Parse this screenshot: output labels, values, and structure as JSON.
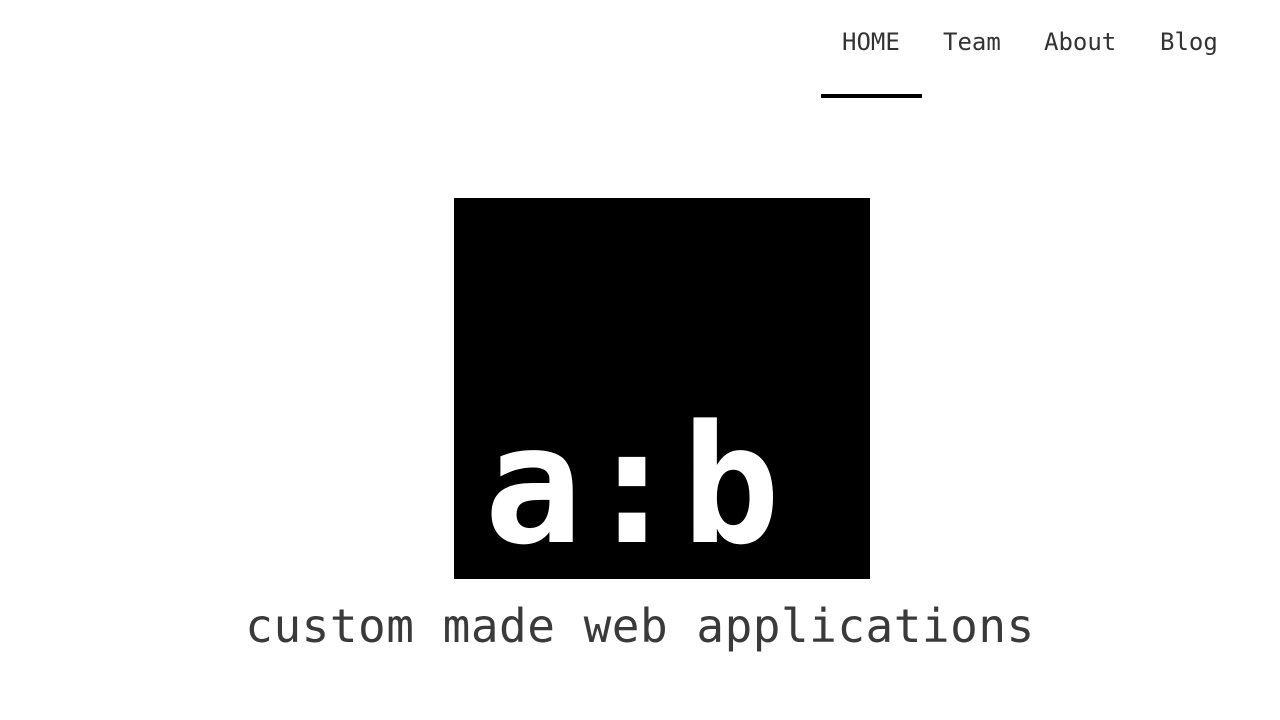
{
  "nav": {
    "items": [
      {
        "label": "HOME",
        "active": true
      },
      {
        "label": "Team",
        "active": false
      },
      {
        "label": "About",
        "active": false
      },
      {
        "label": "Blog",
        "active": false
      }
    ]
  },
  "logo": {
    "text": "a:b",
    "background": "#000000",
    "foreground": "#ffffff"
  },
  "hero": {
    "tagline": "custom made web applications"
  },
  "colors": {
    "text": "#333333",
    "accent_underline": "#000000",
    "background": "#ffffff"
  }
}
